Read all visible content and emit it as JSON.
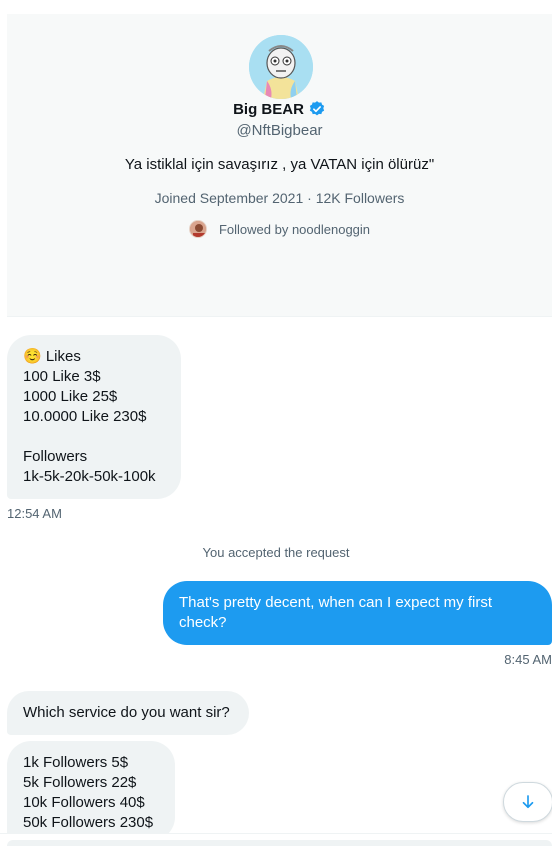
{
  "profile": {
    "name": "Big BEAR",
    "handle": "@NftBigbear",
    "bio": "Ya istiklal için savaşırız , ya VATAN için ölürüz\"",
    "meta": "Joined September 2021 · 12K Followers",
    "followed_by": "Followed by noodlenoggin",
    "verified_color": "#1d9bf0"
  },
  "messages": {
    "m1": [
      "☺️ Likes",
      "100 Like 3$",
      "1000 Like 25$",
      "10.0000 Like 230$",
      "",
      "Followers",
      "1k-5k-20k-50k-100k"
    ],
    "m1_time": "12:54 AM",
    "system": "You accepted the request",
    "m2": [
      "That's pretty decent, when can I expect my first",
      "check?"
    ],
    "m2_time": "8:45 AM",
    "m3": [
      "Which service do you want sir?"
    ],
    "m4": [
      "1k Followers 5$",
      "5k Followers 22$",
      "10k Followers 40$",
      "50k Followers 230$"
    ]
  },
  "colors": {
    "accent": "#1d9bf0",
    "incoming_bubble": "#eff3f4",
    "muted_text": "#536471"
  },
  "icons": {
    "scroll": "arrow-down-icon",
    "verified": "verified-badge-icon"
  }
}
